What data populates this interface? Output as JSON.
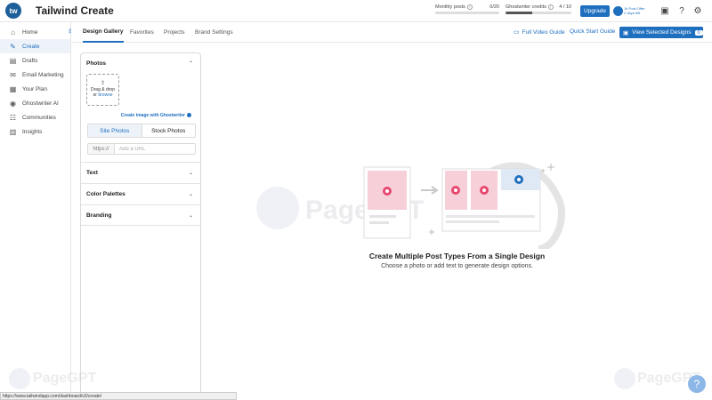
{
  "app": {
    "logo_text": "tw",
    "title": "Tailwind Create"
  },
  "quota": {
    "monthly_posts": {
      "label": "Monthly posts",
      "value": "0/20",
      "fraction": 0.0
    },
    "ghostwriter_credits": {
      "label": "Ghostwriter credits",
      "value": "4 / 10",
      "fraction": 0.4
    }
  },
  "header": {
    "upgrade_label": "Upgrade",
    "offer_line1": "1¢ Post Offer",
    "offer_line2": "2 days left",
    "icons": [
      "gift-icon",
      "help-icon",
      "gear-icon"
    ]
  },
  "sidebar": {
    "items": [
      {
        "label": "Home",
        "icon": "home-icon",
        "glyph": "⌂"
      },
      {
        "label": "Create",
        "icon": "pencil-icon",
        "glyph": "✎"
      },
      {
        "label": "Drafts",
        "icon": "drafts-icon",
        "glyph": "▤"
      },
      {
        "label": "Email Marketing",
        "icon": "email-icon",
        "glyph": "✉"
      },
      {
        "label": "Your Plan",
        "icon": "calendar-icon",
        "glyph": "▦"
      },
      {
        "label": "Ghostwriter AI",
        "icon": "ghostwriter-icon",
        "glyph": "◉"
      },
      {
        "label": "Communities",
        "icon": "communities-icon",
        "glyph": "☷"
      },
      {
        "label": "Insights",
        "icon": "insights-icon",
        "glyph": "▥"
      }
    ],
    "active_index": 1
  },
  "tabs": [
    "Design Gallery",
    "Favorites",
    "Projects",
    "Brand Settings"
  ],
  "guides": {
    "video": "Full Video Guide",
    "quick": "Quick Start Guide"
  },
  "view_selected": {
    "label": "View Selected Designs",
    "count": "0"
  },
  "panel": {
    "photos_title": "Photos",
    "dropzone_line1": "Drag & drop",
    "dropzone_line2": "or",
    "dropzone_browse": "browse",
    "ghost_link": "Create image with Ghostwriter",
    "seg_site": "Site Photos",
    "seg_stock": "Stock Photos",
    "url_prefix": "https://",
    "url_placeholder": "Add a URL",
    "sections": [
      "Text",
      "Color Palettes",
      "Branding"
    ]
  },
  "empty_state": {
    "title": "Create Multiple Post Types From a Single Design",
    "subtitle": "Choose a photo or add text to generate design options."
  },
  "watermark": "PageGPT",
  "status_url": "https://www.tailwindapp.com/dashboard/v2/create/",
  "colors": {
    "accent": "#1f6fbf",
    "pink": "#e8486f"
  }
}
